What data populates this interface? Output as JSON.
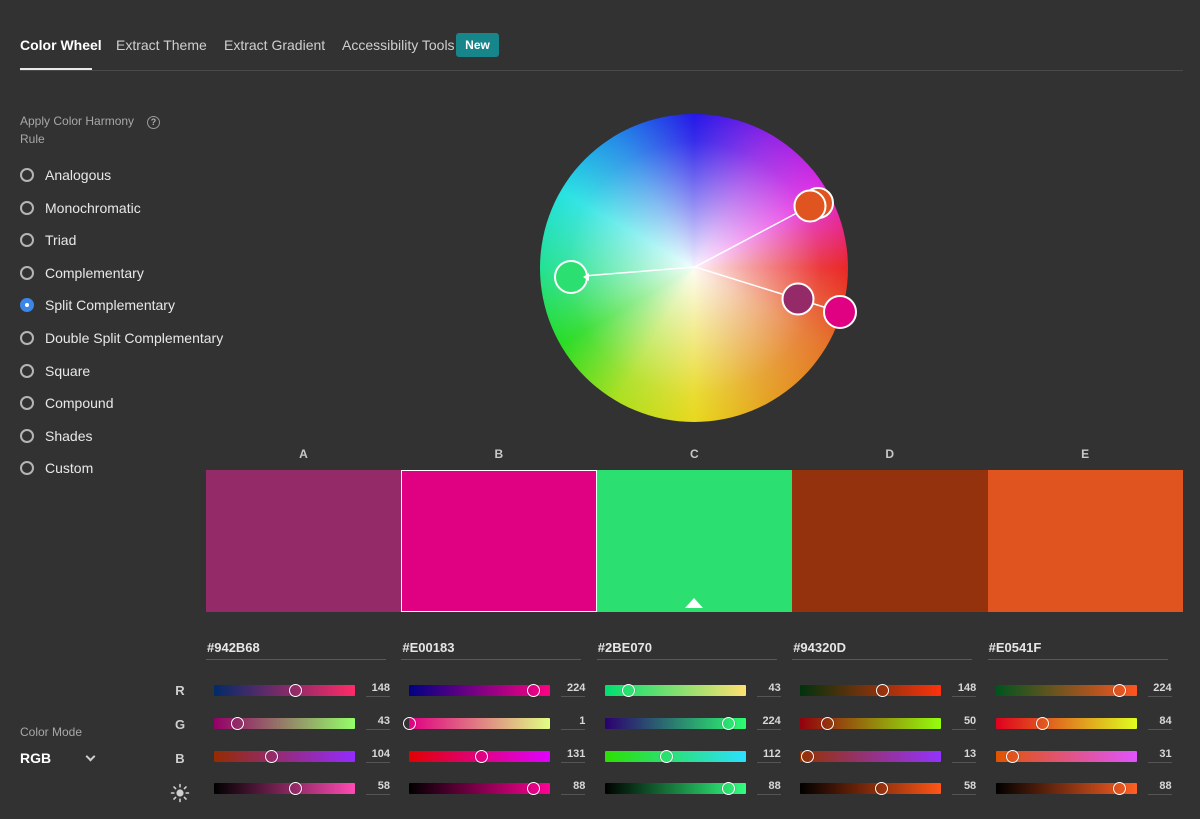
{
  "tabs": [
    {
      "label": "Color Wheel",
      "active": true
    },
    {
      "label": "Extract Theme",
      "active": false
    },
    {
      "label": "Extract Gradient",
      "active": false
    },
    {
      "label": "Accessibility Tools",
      "active": false
    }
  ],
  "new_badge": "New",
  "harmony": {
    "label": "Apply Color Harmony Rule",
    "help_icon": "question-circle-icon",
    "selected": "Split Complementary",
    "rules": [
      "Analogous",
      "Monochromatic",
      "Triad",
      "Complementary",
      "Split Complementary",
      "Double Split Complementary",
      "Square",
      "Compound",
      "Shades",
      "Custom"
    ]
  },
  "color_mode": {
    "label": "Color Mode",
    "value": "RGB"
  },
  "channels": [
    "R",
    "G",
    "B"
  ],
  "brightness_icon": "sun-icon",
  "swatches": [
    {
      "letter": "A",
      "hex": "#942B68",
      "rgb": [
        148,
        43,
        104
      ],
      "brightness": 58
    },
    {
      "letter": "B",
      "hex": "#E00183",
      "rgb": [
        224,
        1,
        131
      ],
      "brightness": 88
    },
    {
      "letter": "C",
      "hex": "#2BE070",
      "rgb": [
        43,
        224,
        112
      ],
      "brightness": 88
    },
    {
      "letter": "D",
      "hex": "#94320D",
      "rgb": [
        148,
        50,
        13
      ],
      "brightness": 58
    },
    {
      "letter": "E",
      "hex": "#E0541F",
      "rgb": [
        224,
        84,
        31
      ],
      "brightness": 88
    }
  ],
  "selected_swatch": "B",
  "base_swatch": "C"
}
